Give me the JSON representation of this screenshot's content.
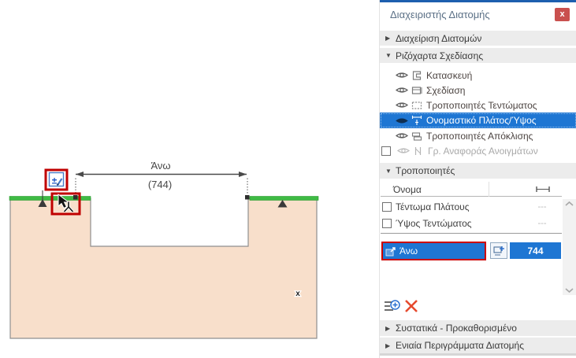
{
  "colors": {
    "selection_blue": "#1e76d3",
    "annotation_red": "#cc0000",
    "close_red": "#c9504e",
    "green_edge": "#3fbb44",
    "profile_fill": "#f8dfcb",
    "accent_blue": "#2a6fd0"
  },
  "window": {
    "title": "Διαχειριστής Διατομής",
    "close_glyph": "x"
  },
  "sections": {
    "manage": {
      "label": "Διαχείριση Διατομών",
      "arrow": "▶"
    },
    "tracing": {
      "label": "Ριζόχαρτα Σχεδίασης",
      "arrow": "▼"
    },
    "modifiers": {
      "label": "Τροποποιητές",
      "arrow": "▼"
    },
    "components": {
      "label": "Συστατικά - Προκαθορισμένο",
      "arrow": "▶"
    },
    "outlines": {
      "label": "Ενιαία Περιγράμματα Διατομής",
      "arrow": "▶"
    }
  },
  "tracing_layers": [
    {
      "label": "Κατασκευή"
    },
    {
      "label": "Σχεδίαση"
    },
    {
      "label": "Τροποποιητές Τεντώματος"
    },
    {
      "label": "Ονομαστικό Πλάτος/Ύψος"
    },
    {
      "label": "Τροποποιητές Απόκλισης"
    },
    {
      "label": "Γρ. Αναφοράς Ανοιγμάτων"
    }
  ],
  "modifier_table": {
    "name_header": "Όνομα",
    "rows": [
      {
        "label": "Τέντωμα Πλάτους",
        "value": "---"
      },
      {
        "label": "Ύψος Τεντώματος",
        "value": "---"
      }
    ]
  },
  "selected_modifier": {
    "label": "Άνω",
    "value": "744"
  },
  "canvas": {
    "dim_label": "Άνω",
    "dim_value": "(744)",
    "marker_glyph": "x"
  }
}
